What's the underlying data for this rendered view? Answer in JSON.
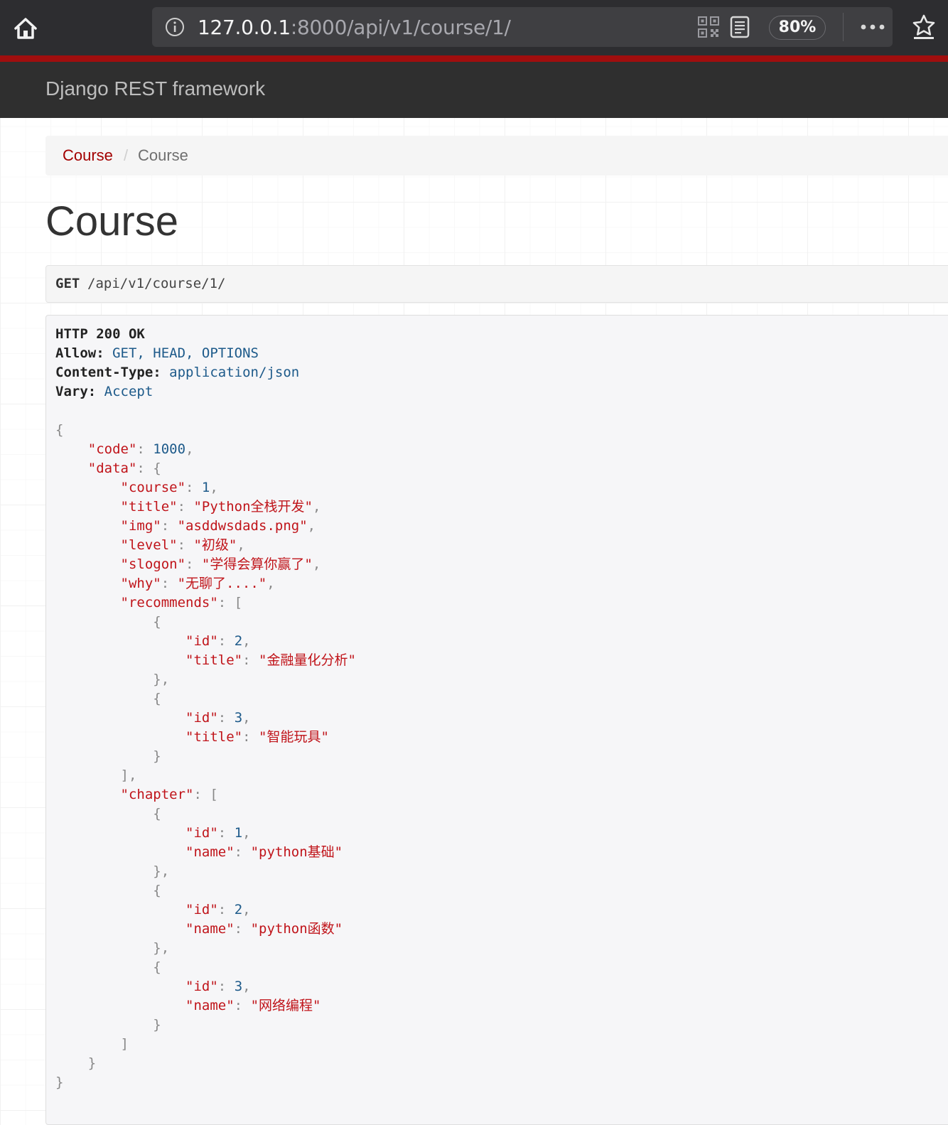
{
  "browser": {
    "url_host": "127.0.0.1",
    "url_rest": ":8000/api/v1/course/1/",
    "zoom": "80%"
  },
  "navbar": {
    "brand": "Django REST framework"
  },
  "breadcrumb": {
    "link": "Course",
    "separator": "/",
    "active": "Course"
  },
  "page": {
    "title": "Course"
  },
  "request": {
    "method": "GET",
    "path": "/api/v1/course/1/"
  },
  "response": {
    "status": "HTTP 200 OK",
    "headers": [
      {
        "name": "Allow:",
        "value": "GET, HEAD, OPTIONS"
      },
      {
        "name": "Content-Type:",
        "value": "application/json"
      },
      {
        "name": "Vary:",
        "value": "Accept"
      }
    ],
    "body": {
      "code": "1000",
      "course": "1",
      "title": "\"Python全栈开发\"",
      "img": "\"asddwsdads.png\"",
      "level": "\"初级\"",
      "slogon": "\"学得会算你赢了\"",
      "why": "\"无聊了....\"",
      "recommends": [
        {
          "id": "2",
          "title": "\"金融量化分析\""
        },
        {
          "id": "3",
          "title": "\"智能玩具\""
        }
      ],
      "chapter": [
        {
          "id": "1",
          "name": "\"python基础\""
        },
        {
          "id": "2",
          "name": "\"python函数\""
        },
        {
          "id": "3",
          "name": "\"网络编程\""
        }
      ]
    }
  }
}
